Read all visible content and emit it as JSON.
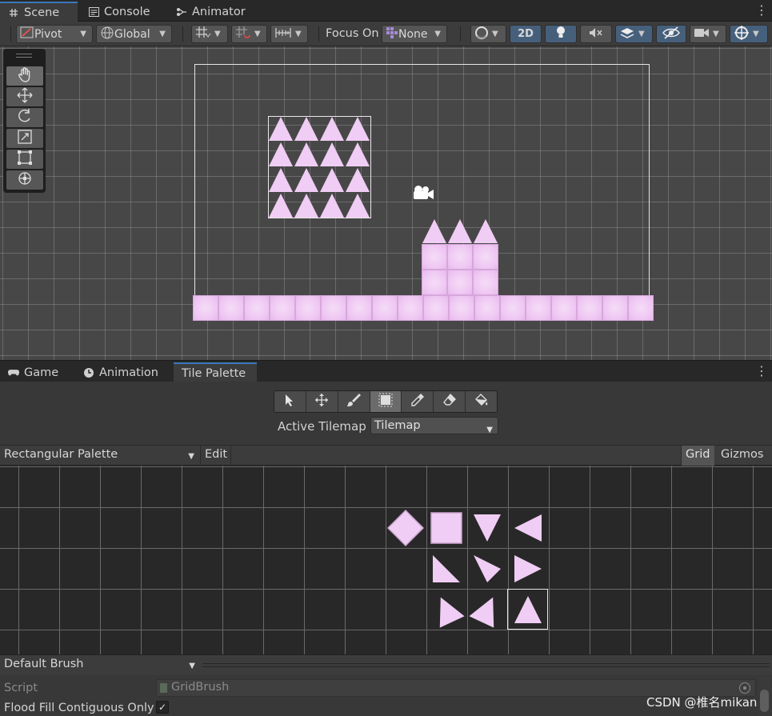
{
  "top_tabs": [
    {
      "label": "Scene",
      "icon": "hash-icon",
      "active": true
    },
    {
      "label": "Console",
      "icon": "console-icon",
      "active": false
    },
    {
      "label": "Animator",
      "icon": "animator-icon",
      "active": false
    }
  ],
  "scene_toolbar": {
    "pivot": "Pivot",
    "global": "Global",
    "focus_on_label": "Focus On",
    "focus_none": "None",
    "mode_2d": "2D"
  },
  "bottom_tabs": [
    {
      "label": "Game",
      "icon": "gamepad-icon",
      "active": false
    },
    {
      "label": "Animation",
      "icon": "clock-icon",
      "active": false
    },
    {
      "label": "Tile Palette",
      "icon": "",
      "active": true
    }
  ],
  "tile_palette": {
    "active_tilemap_label": "Active Tilemap",
    "active_tilemap_value": "Tilemap",
    "palette": "Rectangular Palette",
    "edit": "Edit",
    "grid": "Grid",
    "gizmos": "Gizmos",
    "brush": "Default Brush",
    "script_label": "Script",
    "script_value": "GridBrush",
    "flood_fill_label": "Flood Fill Contiguous Only",
    "flood_fill_checked": "✓"
  },
  "watermark": "CSDN @椎名mikan",
  "colors": {
    "accent": "#3a79bb",
    "tile_pink": "#f0cdf4",
    "blue_button": "#46607c"
  }
}
